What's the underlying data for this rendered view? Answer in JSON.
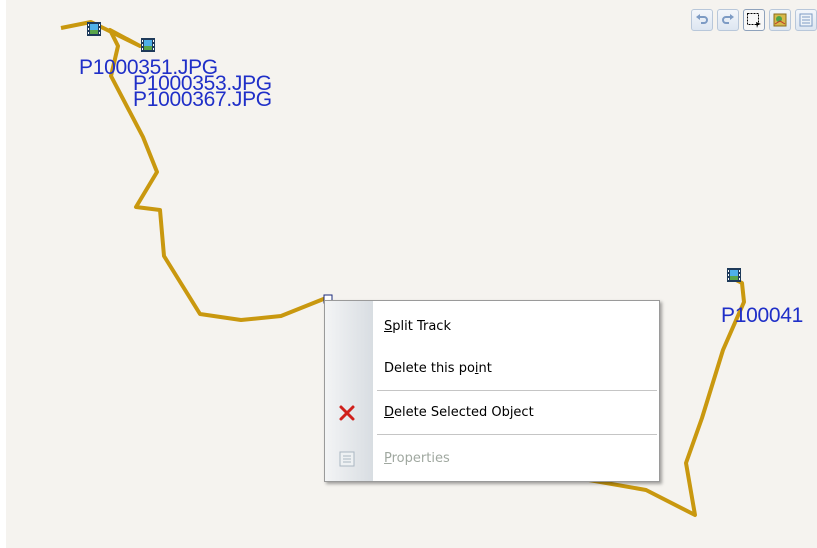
{
  "map": {
    "background": "#f5f3ef",
    "track_color": "#c9980f",
    "photos": [
      {
        "id": "p351",
        "label": "P1000351.JPG"
      },
      {
        "id": "p353",
        "label": "P1000353.JPG"
      },
      {
        "id": "p367",
        "label": "P1000367.JPG"
      },
      {
        "id": "p41x",
        "label": "P100041"
      }
    ]
  },
  "toolbar": {
    "buttons": [
      {
        "name": "undo",
        "icon": "undo-icon"
      },
      {
        "name": "redo",
        "icon": "redo-icon"
      },
      {
        "name": "select",
        "icon": "select-rectangle-icon"
      },
      {
        "name": "layers",
        "icon": "map-layers-icon"
      },
      {
        "name": "properties",
        "icon": "properties-icon"
      }
    ]
  },
  "context_menu": {
    "items": [
      {
        "label": "Split Track",
        "underline": "S",
        "icon": null,
        "enabled": true
      },
      {
        "label": "Delete this point",
        "underline": "i",
        "icon": null,
        "enabled": true
      },
      {
        "label": "Delete Selected Object",
        "underline": "D",
        "icon": "red-x-icon",
        "enabled": true
      },
      {
        "label": "Properties",
        "underline": "P",
        "icon": "properties-icon",
        "enabled": false
      }
    ]
  }
}
